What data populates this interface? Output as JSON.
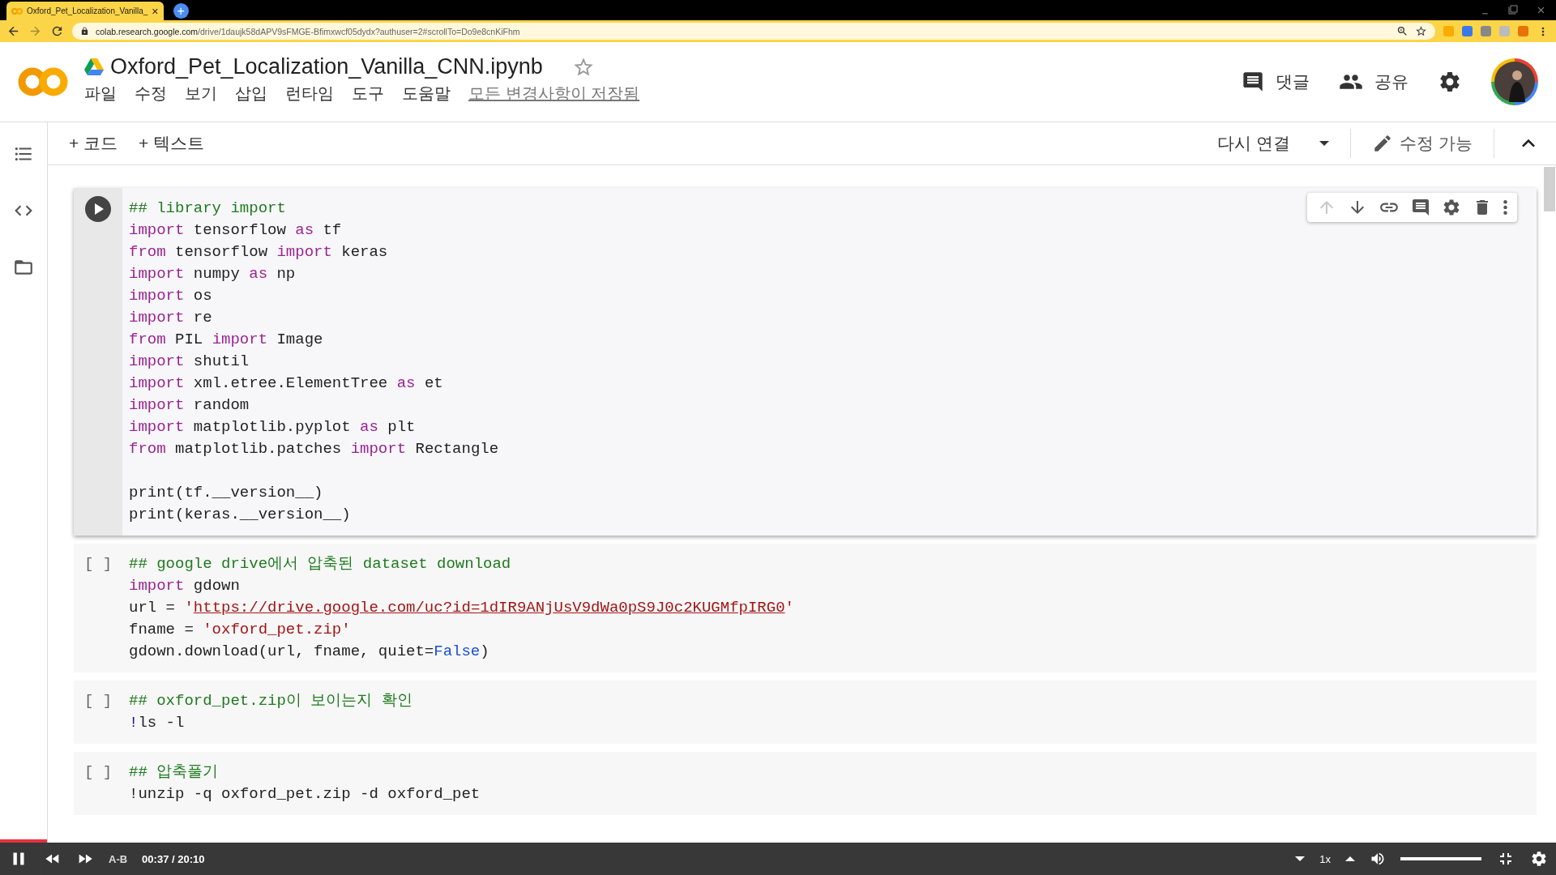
{
  "browser": {
    "tab": {
      "title": "Oxford_Pet_Localization_Vanilla_",
      "close": "×",
      "selected": true
    },
    "new_tab": "+",
    "address": {
      "domain": "colab.research.google.com",
      "path": "/drive/1daujk58dAPV9sFMGE-Bfimxwcf05dydx?authuser=2#scrollTo=Do9e8cnKiFhm"
    }
  },
  "notebook": {
    "title": "Oxford_Pet_Localization_Vanilla_CNN.ipynb",
    "starred": false,
    "menu": [
      "파일",
      "수정",
      "보기",
      "삽입",
      "런타임",
      "도구",
      "도움말"
    ],
    "save_status": "모든 변경사항이 저장됨"
  },
  "header_actions": [
    {
      "kind": "comment",
      "label": "댓글"
    },
    {
      "kind": "share",
      "label": "공유"
    }
  ],
  "sidebar": [
    {
      "kind": "toc"
    },
    {
      "kind": "code"
    },
    {
      "kind": "files"
    }
  ],
  "toolbar": {
    "add_buttons": [
      "+ 코드",
      "+ 텍스트"
    ],
    "connect": "다시 연결",
    "edit": "수정 가능"
  },
  "cell_toolbar": [
    {
      "kind": "up",
      "disabled": true
    },
    {
      "kind": "down",
      "disabled": false
    },
    {
      "kind": "link",
      "disabled": false
    },
    {
      "kind": "comment",
      "disabled": false
    },
    {
      "kind": "settings",
      "disabled": false
    },
    {
      "kind": "delete",
      "disabled": false
    },
    {
      "kind": "more",
      "disabled": false
    }
  ],
  "cells": [
    {
      "selected": true,
      "lines": [
        {
          "kind": "code",
          "tokens": [
            {
              "kind": "comment",
              "text": "## library import"
            }
          ]
        },
        {
          "kind": "code",
          "tokens": [
            {
              "kind": "keyword",
              "text": "import"
            },
            {
              "kind": "plain",
              "text": " tensorflow "
            },
            {
              "kind": "keyword",
              "text": "as"
            },
            {
              "kind": "plain",
              "text": " tf"
            }
          ]
        },
        {
          "kind": "code",
          "tokens": [
            {
              "kind": "keyword",
              "text": "from"
            },
            {
              "kind": "plain",
              "text": " tensorflow "
            },
            {
              "kind": "keyword",
              "text": "import"
            },
            {
              "kind": "plain",
              "text": " keras"
            }
          ]
        },
        {
          "kind": "code",
          "tokens": [
            {
              "kind": "keyword",
              "text": "import"
            },
            {
              "kind": "plain",
              "text": " numpy "
            },
            {
              "kind": "keyword",
              "text": "as"
            },
            {
              "kind": "plain",
              "text": " np"
            }
          ]
        },
        {
          "kind": "code",
          "tokens": [
            {
              "kind": "keyword",
              "text": "import"
            },
            {
              "kind": "plain",
              "text": " os"
            }
          ]
        },
        {
          "kind": "code",
          "tokens": [
            {
              "kind": "keyword",
              "text": "import"
            },
            {
              "kind": "plain",
              "text": " re"
            }
          ]
        },
        {
          "kind": "code",
          "tokens": [
            {
              "kind": "keyword",
              "text": "from"
            },
            {
              "kind": "plain",
              "text": " PIL "
            },
            {
              "kind": "keyword",
              "text": "import"
            },
            {
              "kind": "plain",
              "text": " Image"
            }
          ]
        },
        {
          "kind": "code",
          "tokens": [
            {
              "kind": "keyword",
              "text": "import"
            },
            {
              "kind": "plain",
              "text": " shutil"
            }
          ]
        },
        {
          "kind": "code",
          "tokens": [
            {
              "kind": "keyword",
              "text": "import"
            },
            {
              "kind": "plain",
              "text": " xml.etree.ElementTree "
            },
            {
              "kind": "keyword",
              "text": "as"
            },
            {
              "kind": "plain",
              "text": " et"
            }
          ]
        },
        {
          "kind": "code",
          "tokens": [
            {
              "kind": "keyword",
              "text": "import"
            },
            {
              "kind": "plain",
              "text": " random"
            }
          ]
        },
        {
          "kind": "code",
          "tokens": [
            {
              "kind": "keyword",
              "text": "import"
            },
            {
              "kind": "plain",
              "text": " matplotlib.pyplot "
            },
            {
              "kind": "keyword",
              "text": "as"
            },
            {
              "kind": "plain",
              "text": " plt"
            }
          ]
        },
        {
          "kind": "code",
          "tokens": [
            {
              "kind": "keyword",
              "text": "from"
            },
            {
              "kind": "plain",
              "text": " matplotlib.patches "
            },
            {
              "kind": "keyword",
              "text": "import"
            },
            {
              "kind": "plain",
              "text": " Rectangle"
            }
          ]
        },
        {
          "kind": "blank"
        },
        {
          "kind": "code",
          "tokens": [
            {
              "kind": "plain",
              "text": "print(tf.__version__)"
            }
          ]
        },
        {
          "kind": "code",
          "tokens": [
            {
              "kind": "plain",
              "text": "print(keras.__version__)"
            }
          ]
        }
      ]
    },
    {
      "selected": false,
      "prompt": "[ ]",
      "lines": [
        {
          "kind": "code",
          "tokens": [
            {
              "kind": "comment",
              "text": "## google drive에서 압축된 dataset download"
            }
          ]
        },
        {
          "kind": "code",
          "tokens": [
            {
              "kind": "keyword",
              "text": "import"
            },
            {
              "kind": "plain",
              "text": " gdown"
            }
          ]
        },
        {
          "kind": "code",
          "tokens": [
            {
              "kind": "plain",
              "text": "url = "
            },
            {
              "kind": "string",
              "text": "'"
            },
            {
              "kind": "url",
              "text": "https://drive.google.com/uc?id=1dIR9ANjUsV9dWa0pS9J0c2KUGMfpIRG0"
            },
            {
              "kind": "string",
              "text": "'"
            }
          ]
        },
        {
          "kind": "code",
          "tokens": [
            {
              "kind": "plain",
              "text": "fname = "
            },
            {
              "kind": "string",
              "text": "'oxford_pet.zip'"
            }
          ]
        },
        {
          "kind": "code",
          "tokens": [
            {
              "kind": "plain",
              "text": "gdown.download(url, fname, quiet="
            },
            {
              "kind": "constant",
              "text": "False"
            },
            {
              "kind": "plain",
              "text": ")"
            }
          ]
        }
      ]
    },
    {
      "selected": false,
      "prompt": "[ ]",
      "lines": [
        {
          "kind": "code",
          "tokens": [
            {
              "kind": "comment",
              "text": "## oxford_pet.zip이 보이는지 확인"
            }
          ]
        },
        {
          "kind": "code",
          "tokens": [
            {
              "kind": "bang",
              "text": "!"
            },
            {
              "kind": "plain",
              "text": "ls -l"
            }
          ]
        }
      ]
    },
    {
      "selected": false,
      "prompt": "[ ]",
      "lines": [
        {
          "kind": "code",
          "tokens": [
            {
              "kind": "comment",
              "text": "## 압축풀기"
            }
          ]
        },
        {
          "kind": "code",
          "tokens": [
            {
              "kind": "plain",
              "text": "!unzip -q oxford_pet.zip -d oxford_pet"
            }
          ]
        }
      ]
    }
  ],
  "player": {
    "playing": true,
    "progress": {
      "level": 0.03
    },
    "ab": "A-B",
    "time": "00:37 / 20:10",
    "speed": "1x",
    "volume": {
      "level": 1
    }
  }
}
